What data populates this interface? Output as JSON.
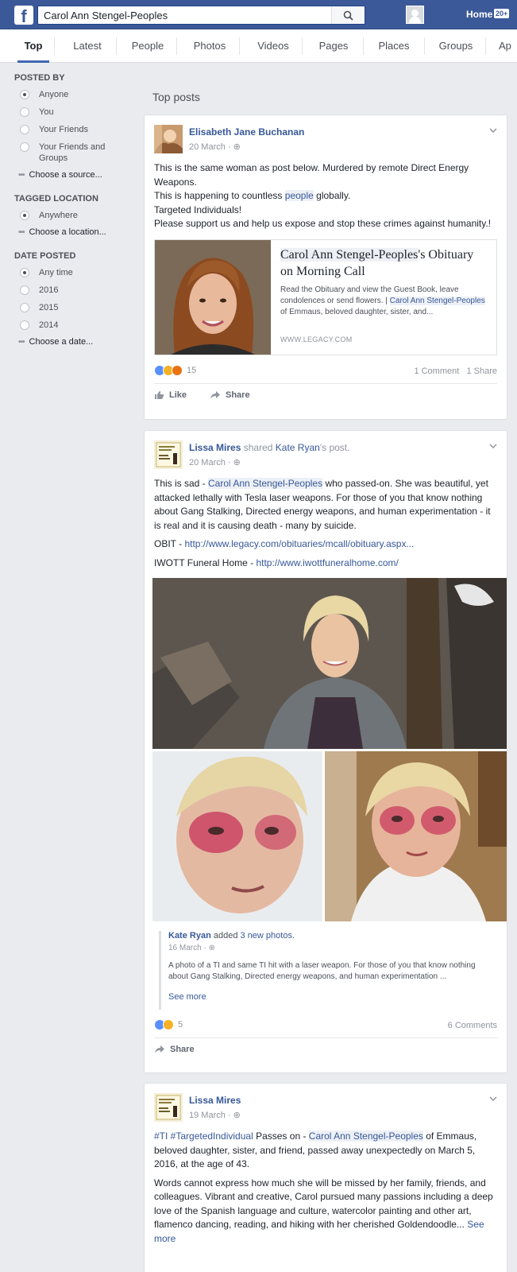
{
  "search": {
    "value": "Carol Ann Stengel-Peoples"
  },
  "topbar": {
    "home_label": "Home",
    "home_count": "20+"
  },
  "tabs": [
    "Top",
    "Latest",
    "People",
    "Photos",
    "Videos",
    "Pages",
    "Places",
    "Groups",
    "Ap"
  ],
  "filters": {
    "posted_by": {
      "heading": "POSTED BY",
      "options": [
        "Anyone",
        "You",
        "Your Friends",
        "Your Friends and Groups"
      ],
      "selected": "Anyone",
      "choose": "Choose a source..."
    },
    "tagged_location": {
      "heading": "TAGGED LOCATION",
      "options": [
        "Anywhere"
      ],
      "selected": "Anywhere",
      "choose": "Choose a location..."
    },
    "date_posted": {
      "heading": "DATE POSTED",
      "options": [
        "Any time",
        "2016",
        "2015",
        "2014"
      ],
      "selected": "Any time",
      "choose": "Choose a date..."
    }
  },
  "main": {
    "section_title": "Top posts"
  },
  "posts": [
    {
      "author": "Elisabeth Jane Buchanan",
      "date": "20 March",
      "text": {
        "line1": "This is the same woman as post below. Murdered by remote Direct Energy Weapons.",
        "line2_pre": "This is happening to countless ",
        "line2_link": "people",
        "line2_post": " globally.",
        "line3": "Targeted Individuals!",
        "line4": "Please support us and help us expose and stop these crimes against humanity.!"
      },
      "link_card": {
        "title_hl": "Carol Ann Stengel-Peoples",
        "title_rest": "'s Obituary on Morning Call",
        "desc_pre": "Read the Obituary and view the Guest Book, leave condolences or send flowers. | ",
        "desc_hl": "Carol Ann Stengel-Peoples",
        "desc_post": " of Emmaus, beloved daughter, sister, and...",
        "domain": "WWW.LEGACY.COM"
      },
      "reaction_count": "15",
      "comments": "1 Comment",
      "shares": "1 Share",
      "like_label": "Like",
      "share_label": "Share"
    },
    {
      "author": "Lissa Mires",
      "shared_text": "shared",
      "shared_name": "Kate Ryan",
      "shared_suffix": "'s post.",
      "date": "20 March",
      "text": {
        "pre": "This is sad - ",
        "hl": "Carol Ann Stengel-Peoples",
        "post": " who passed-on. She was beautiful, yet attacked lethally with Tesla laser weapons. For those of you that know nothing about Gang Stalking, Directed energy weapons, and human experimentation - it is real and it is causing death - many by suicide.",
        "obit_label": "OBIT - ",
        "obit_url": "http://www.legacy.com/obituaries/mcall/obituary.aspx...",
        "funeral_label": "IWOTT Funeral Home - ",
        "funeral_url": "http://www.iwottfuneralhome.com/"
      },
      "quote": {
        "author": "Kate Ryan",
        "added": "added",
        "photos": "3 new photos.",
        "date": "16 March",
        "text": "A photo of a TI and same TI hit with a laser weapon. For those of you that know nothing about Gang Stalking, Directed energy weapons, and human experimentation ...",
        "see_more": "See more"
      },
      "reaction_count": "5",
      "comments": "6 Comments",
      "share_label": "Share"
    },
    {
      "author": "Lissa Mires",
      "date": "19 March",
      "text": {
        "tags": "#TI #TargetedIndividual",
        "pre": " Passes on - ",
        "hl": "Carol Ann Stengel-Peoples",
        "post": " of Emmaus, beloved daughter, sister, and friend, passed away unexpectedly on March 5, 2016, at the age of 43.",
        "para2": "Words cannot express how much she will be missed by her family, friends, and colleagues. Vibrant and creative, Carol pursued many passions including a deep love of the Spanish language and culture, watercolor painting and other art, flamenco dancing, reading, and hiking with her cherished Goldendoodle...",
        "see_more": "See more"
      }
    }
  ]
}
